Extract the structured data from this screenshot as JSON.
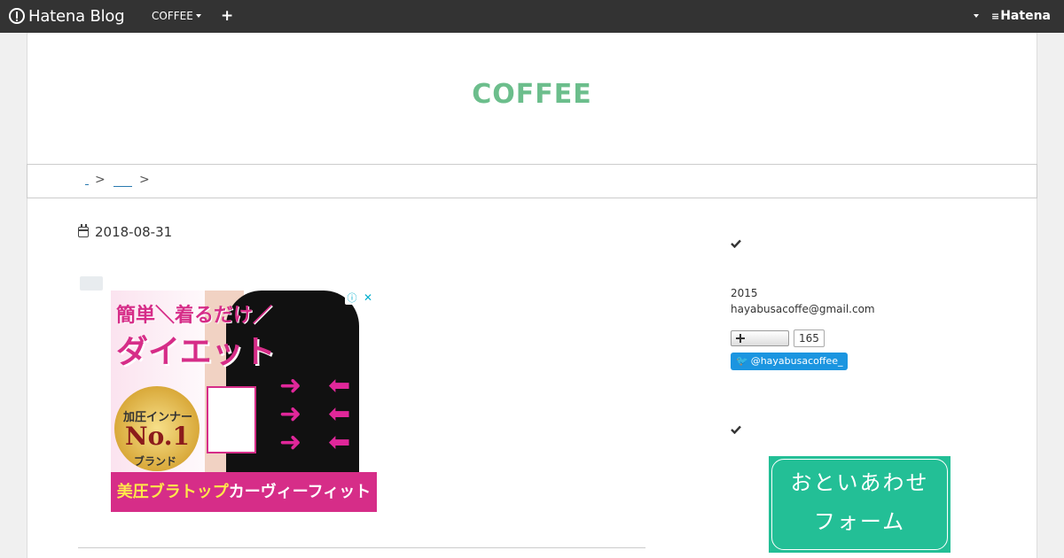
{
  "topbar": {
    "brand": "Hatena Blog",
    "blog_menu": "COFFEE",
    "add_label": "+",
    "hatena_logo": "Hatena"
  },
  "blog": {
    "title": "COFFEE"
  },
  "breadcrumb": {
    "separator": ">"
  },
  "entry": {
    "date": "2018-08-31"
  },
  "ad": {
    "line1": "簡単＼着るだけ／",
    "line2": "ダイエット",
    "medal_top": "加圧インナー",
    "medal_no": "No.1",
    "medal_brand": "ブランド",
    "bottom_yellow": "美圧ブラトップ",
    "bottom_white": "カーヴィーフィット",
    "info": "ⓘ",
    "close": "✕"
  },
  "sidebar": {
    "profile_year": "2015",
    "profile_email": "hayabusacoffe@gmail.com",
    "subscribe_count": "165",
    "twitter_handle": "@hayabusacoffee_",
    "contact_line1": "おといあわせ",
    "contact_line2": "フォーム"
  }
}
